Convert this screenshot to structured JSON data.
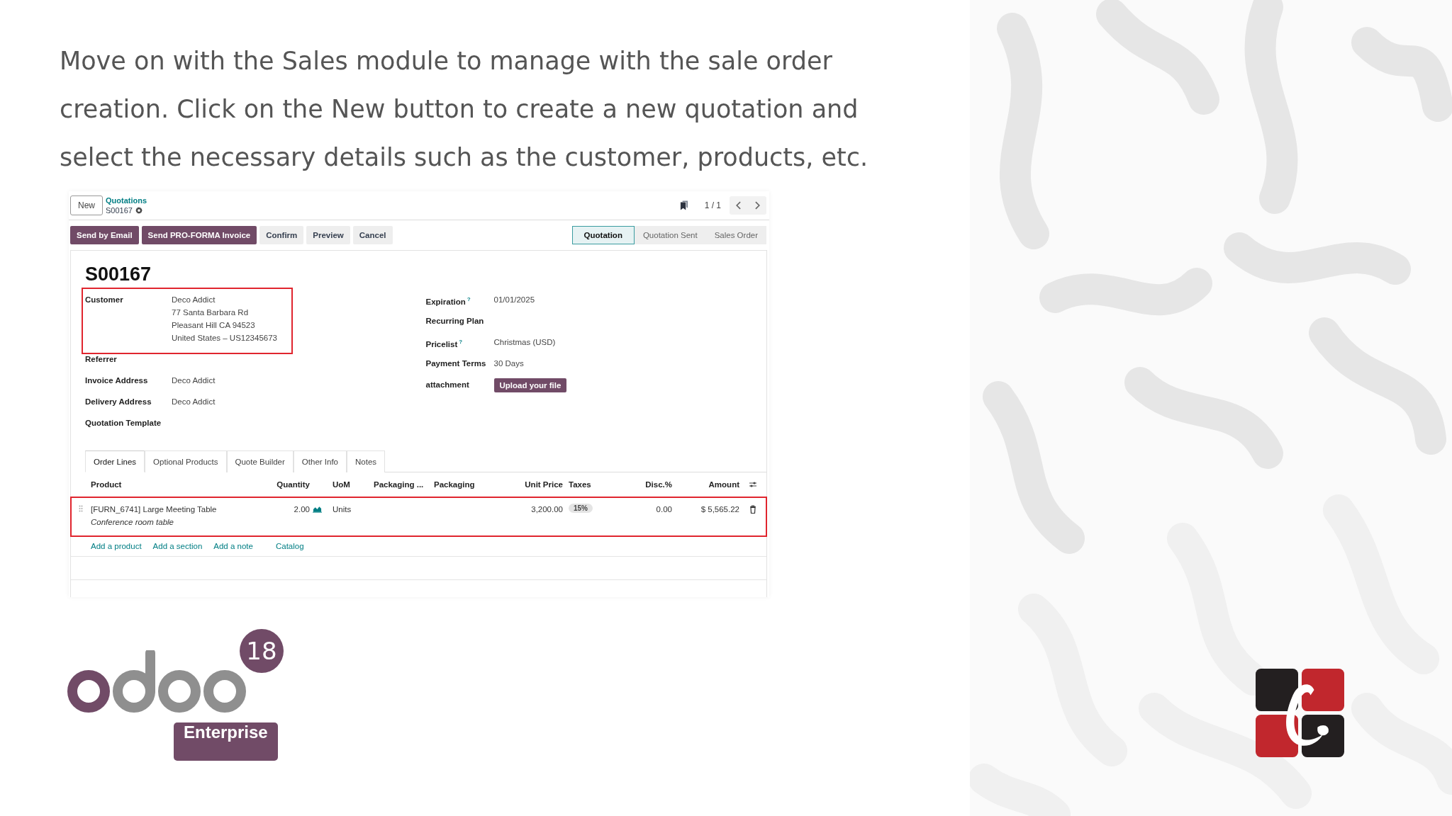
{
  "instruction": "Move on with the Sales module to manage with the sale order creation. Click on the New button to create a new quotation and select the necessary details such as the customer, products, etc.",
  "form": {
    "new_button": "New",
    "breadcrumb": "Quotations",
    "record": "S00167",
    "pager": "1 / 1",
    "actions": [
      {
        "label": "Send by Email",
        "primary": true
      },
      {
        "label": "Send PRO-FORMA Invoice",
        "primary": true
      },
      {
        "label": "Confirm",
        "primary": false
      },
      {
        "label": "Preview",
        "primary": false
      },
      {
        "label": "Cancel",
        "primary": false
      }
    ],
    "stages": [
      {
        "label": "Quotation",
        "selected": true
      },
      {
        "label": "Quotation Sent",
        "selected": false
      },
      {
        "label": "Sales Order",
        "selected": false
      }
    ],
    "title": "S00167",
    "left_fields": [
      {
        "label": "Customer",
        "lines": [
          "Deco Addict",
          "77 Santa Barbara Rd",
          "Pleasant Hill CA 94523",
          "United States – US12345673"
        ],
        "highlighted": true
      },
      {
        "label": "Referrer",
        "highlighted": false
      },
      {
        "label": "Invoice Address",
        "lines": [
          "Deco Addict"
        ],
        "highlighted": false
      },
      {
        "label": "Delivery Address",
        "lines": [
          "Deco Addict"
        ],
        "highlighted": false
      },
      {
        "label": "Quotation Template",
        "highlighted": false
      }
    ],
    "right_fields": [
      {
        "label": "Expiration",
        "help": "?",
        "value": "01/01/2025",
        "kind": "text"
      },
      {
        "label": "Recurring Plan"
      },
      {
        "label": "Pricelist",
        "help": "?",
        "value": "Christmas (USD)",
        "kind": "text"
      },
      {
        "label": "Payment Terms",
        "value": "30 Days",
        "kind": "text"
      },
      {
        "label": "attachment",
        "value": "Upload your file",
        "kind": "button"
      }
    ],
    "tabs": [
      {
        "label": "Order Lines",
        "selected": true
      },
      {
        "label": "Optional Products",
        "selected": false
      },
      {
        "label": "Quote Builder",
        "selected": false
      },
      {
        "label": "Other Info",
        "selected": false
      },
      {
        "label": "Notes",
        "selected": false
      }
    ],
    "columns": [
      "Product",
      "Quantity",
      "UoM",
      "Packaging ...",
      "Packaging",
      "Unit Price",
      "Taxes",
      "Disc.%",
      "Amount"
    ],
    "lines": [
      {
        "product": "[FURN_6741] Large Meeting Table",
        "description": "Conference room table",
        "quantity": "2.00",
        "uom": "Units",
        "unit_price": "3,200.00",
        "taxes": "15%",
        "discount": "0.00",
        "amount": "$ 5,565.22",
        "highlighted": true
      }
    ],
    "add_links": [
      "Add a product",
      "Add a section",
      "Add a note",
      "Catalog"
    ]
  },
  "logo": {
    "version": "18",
    "edition": "Enterprise"
  }
}
